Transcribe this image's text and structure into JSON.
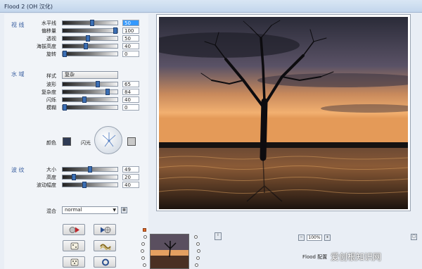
{
  "window": {
    "title": "Flood 2 (OH 汉化)"
  },
  "sections": {
    "horizon": "视 线",
    "water": "水 域",
    "ripple": "波 纹"
  },
  "horizon_rows": [
    {
      "label": "水平线",
      "value": "50",
      "level": 0.53,
      "selected": true
    },
    {
      "label": "偏移量",
      "value": "100",
      "level": 0.97,
      "selected": false
    },
    {
      "label": "透视",
      "value": "50",
      "level": 0.45,
      "selected": false
    },
    {
      "label": "海拔高度",
      "value": "40",
      "level": 0.4,
      "selected": false
    },
    {
      "label": "旋转",
      "value": "0",
      "level": 0.0,
      "selected": false
    }
  ],
  "water": {
    "style_label": "样式",
    "style_value": "复杂",
    "rows": [
      {
        "label": "波形",
        "value": "65",
        "level": 0.63
      },
      {
        "label": "复杂度",
        "value": "84",
        "level": 0.82
      },
      {
        "label": "闪烁",
        "value": "40",
        "level": 0.38
      },
      {
        "label": "模糊",
        "value": "0",
        "level": 0.0
      }
    ],
    "color_label": "颜色",
    "color_swatch": "#2f3b55",
    "glint_label": "闪光",
    "glint_swatch": "#c9c9c9"
  },
  "ripple_rows": [
    {
      "label": "大小",
      "value": "49",
      "level": 0.48
    },
    {
      "label": "高度",
      "value": "20",
      "level": 0.18
    },
    {
      "label": "波动幅度",
      "value": "40",
      "level": 0.38
    }
  ],
  "blend": {
    "label": "混合",
    "value": "normal"
  },
  "zoom": {
    "value": "100%"
  },
  "footer": {
    "brand": "Flood 配置"
  },
  "watermark": {
    "text": "爱创根知识网"
  },
  "icons": {
    "play_preview": "play-record-icon",
    "play_forward": "play-target-icon",
    "dice_1": "dice-icon",
    "wave": "wave-icon",
    "dice_2": "dice-icon",
    "ring": "ring-icon",
    "info": "info-icon"
  }
}
